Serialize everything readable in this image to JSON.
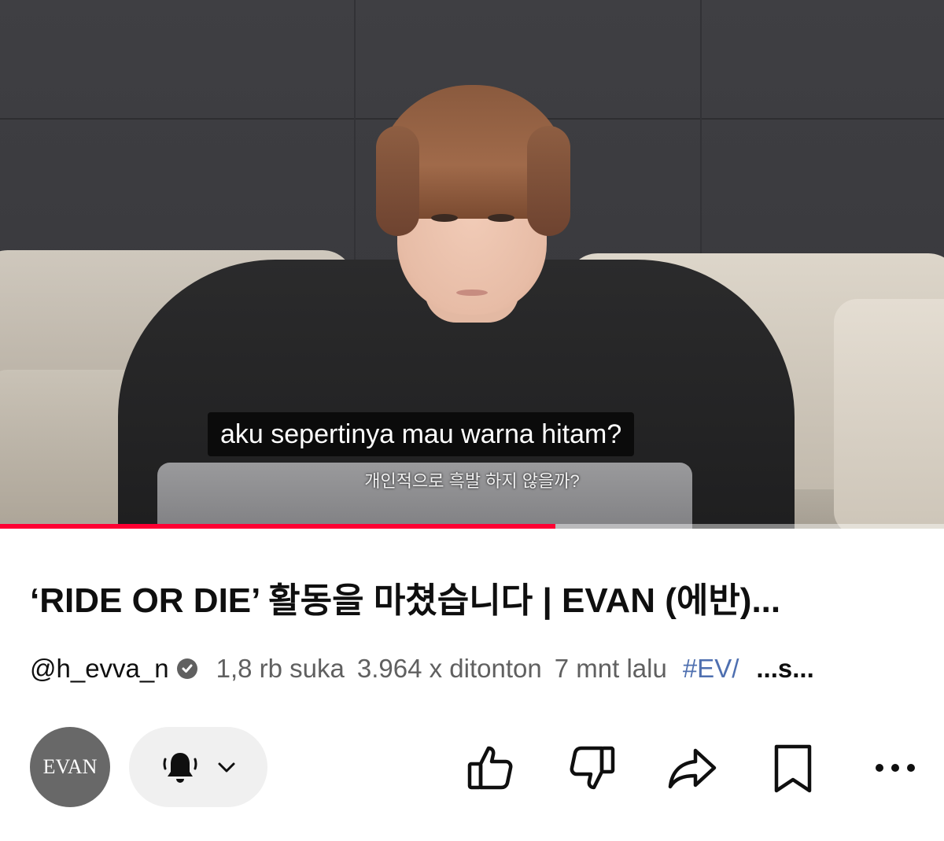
{
  "player": {
    "caption_main": "aku sepertinya mau warna hitam?",
    "caption_sub": "개인적으로 흑발 하지 않을까?",
    "progress_fraction": 0.588
  },
  "video": {
    "title": "‘RIDE OR DIE’ 활동을 마쳤습니다 | EVAN (에반)...",
    "channel_handle": "@h_evva_n",
    "likes": "1,8 rb suka",
    "views": "3.964 x ditonton",
    "age": "7 mnt lalu",
    "hashtag": "#EV/",
    "more": "...s..."
  },
  "channel": {
    "avatar_text": "EVAN"
  },
  "actions": {
    "subscribe_state": "bell-icon",
    "items": [
      "like-icon",
      "dislike-icon",
      "share-icon",
      "save-icon",
      "more-icon"
    ]
  },
  "colors": {
    "progress": "#ff0033",
    "meta_text": "#606060",
    "avatar_bg": "#686868",
    "pill_bg": "#f0f0f0"
  }
}
